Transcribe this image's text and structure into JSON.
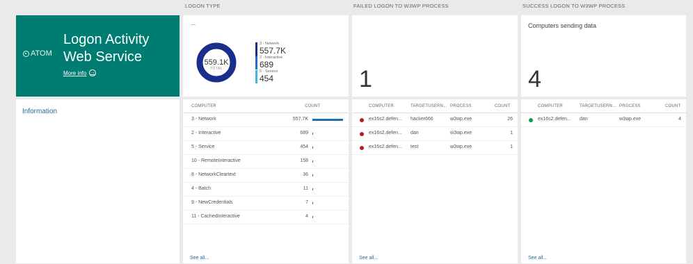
{
  "columns": {
    "logon_type": "LOGON TYPE",
    "failed": "FAILED LOGON TO W3WP PROCESS",
    "success": "SUCCESS LOGON TO W3WP PROCESS"
  },
  "hero": {
    "logo": "ATOM",
    "title_line1": "Logon Activity",
    "title_line2": "Web Service",
    "more_info": "More info",
    "color": "#007d72"
  },
  "info_panel": {
    "label": "Information"
  },
  "donut": {
    "dash": "--",
    "total_value": "559.1K",
    "total_label": "TOTAL",
    "legend": [
      {
        "name": "3 - Network",
        "value": "557.7K",
        "color": "#1c2e8c"
      },
      {
        "name": "2 - Interactive",
        "value": "689",
        "color": "#1f6fd0"
      },
      {
        "name": "5 - Service",
        "value": "454",
        "color": "#3fb8e8"
      }
    ]
  },
  "failed_tile": {
    "value": "1"
  },
  "success_tile": {
    "subtitle": "Computers sending data",
    "value": "4"
  },
  "logon_table": {
    "headers": [
      "COMPUTER",
      "COUNT"
    ],
    "rows": [
      {
        "name": "3 - Network",
        "count": "557.7K",
        "num": 557700
      },
      {
        "name": "2 - Interactive",
        "count": "689",
        "num": 689
      },
      {
        "name": "5 - Service",
        "count": "454",
        "num": 454
      },
      {
        "name": "10 - RemoteInteractive",
        "count": "158",
        "num": 158
      },
      {
        "name": "8 - NetworkCleartext",
        "count": "36",
        "num": 36
      },
      {
        "name": "4 - Batch",
        "count": "11",
        "num": 11
      },
      {
        "name": "9 - NewCredentials",
        "count": "7",
        "num": 7
      },
      {
        "name": "11 - CachedInteractive",
        "count": "4",
        "num": 4
      }
    ],
    "see_all": "See all..."
  },
  "failed_table": {
    "headers": [
      "COMPUTER",
      "TARGETUSERN...",
      "PROCESS",
      "COUNT"
    ],
    "rows": [
      {
        "computer": "ex16s2.defen...",
        "user": "hacker666",
        "process": "w3wp.exe",
        "count": "26"
      },
      {
        "computer": "ex16s2.defen...",
        "user": "dan",
        "process": "w3wp.exe",
        "count": "1"
      },
      {
        "computer": "ex16s2.defen...",
        "user": "test",
        "process": "w3wp.exe",
        "count": "1"
      }
    ],
    "dot_color": "#b0202a",
    "see_all": "See all..."
  },
  "success_table": {
    "headers": [
      "COMPUTER",
      "TARGETUSERN...",
      "PROCESS",
      "COUNT"
    ],
    "rows": [
      {
        "computer": "ex16s2.defen...",
        "user": "dan",
        "process": "w3wp.exe",
        "count": "4"
      }
    ],
    "dot_color": "#1a9850",
    "see_all": "See all..."
  }
}
